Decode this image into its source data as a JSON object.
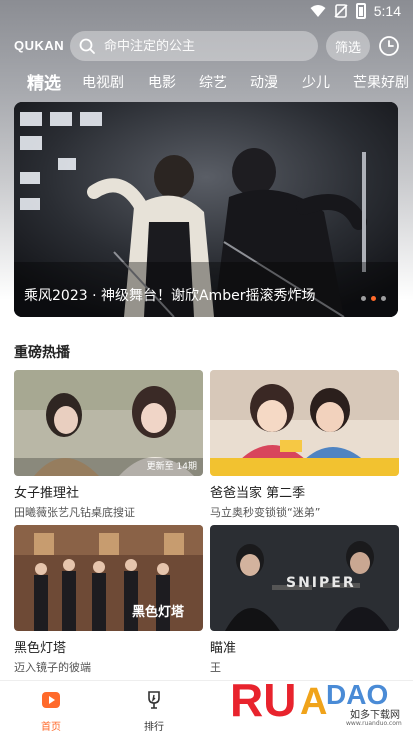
{
  "status_bar": {
    "time": "5:14"
  },
  "top_bar": {
    "logo": "QUKAN",
    "search_placeholder": "命中注定的公主",
    "filter_label": "筛选"
  },
  "tabs": [
    "精选",
    "电视剧",
    "电影",
    "综艺",
    "动漫",
    "少儿",
    "芒果好剧"
  ],
  "banner": {
    "caption": "乘风2023 · 神级舞台！谢欣Amber摇滚秀炸场",
    "dots": 3,
    "active_dot": 1
  },
  "section": {
    "title": "重磅热播",
    "cards": [
      {
        "title": "女子推理社",
        "subtitle": "田曦薇张艺凡钻桌底搜证",
        "badge": "更新至 14期"
      },
      {
        "title": "爸爸当家 第二季",
        "subtitle": "马立奥秒变锁锁“迷弟”",
        "badge": ""
      },
      {
        "title": "黑色灯塔",
        "subtitle": "迈入镜子的彼端",
        "badge": "",
        "overlay": "黑色灯塔"
      },
      {
        "title": "瞄准",
        "subtitle": "王",
        "badge": "",
        "overlay": "SNIPER"
      }
    ]
  },
  "bottom_nav": [
    {
      "label": "首页",
      "icon": "play-home-icon",
      "active": true
    },
    {
      "label": "排行",
      "icon": "trophy-icon",
      "active": false
    }
  ],
  "watermark": {
    "brand": "RUANDAO",
    "sub": "如多下载网",
    "url": "www.ruanduo.com"
  },
  "colors": {
    "accent": "#ff6a2b",
    "header_gray": "#8b8d93"
  }
}
